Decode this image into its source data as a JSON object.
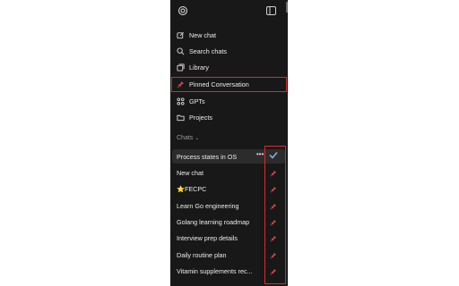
{
  "sidebar": {
    "menu": [
      {
        "label": "New chat",
        "icon": "edit-icon"
      },
      {
        "label": "Search chats",
        "icon": "search-icon"
      },
      {
        "label": "Library",
        "icon": "library-icon"
      },
      {
        "label": "Pinned Conversation",
        "icon": "pin-icon"
      },
      {
        "label": "GPTs",
        "icon": "grid-icon"
      },
      {
        "label": "Projects",
        "icon": "folder-icon"
      }
    ],
    "section_label": "Chats",
    "chats": [
      "Process states in OS",
      "New chat",
      "⭐FECPC",
      "Learn Go engineering",
      "Golang learning roadmap",
      "Interview prep details",
      "Daily routine plan",
      "Vitamin supplements rec..."
    ],
    "more_label": "•••",
    "accent_red": "#e3262b",
    "pin_color": "#d9434c"
  }
}
